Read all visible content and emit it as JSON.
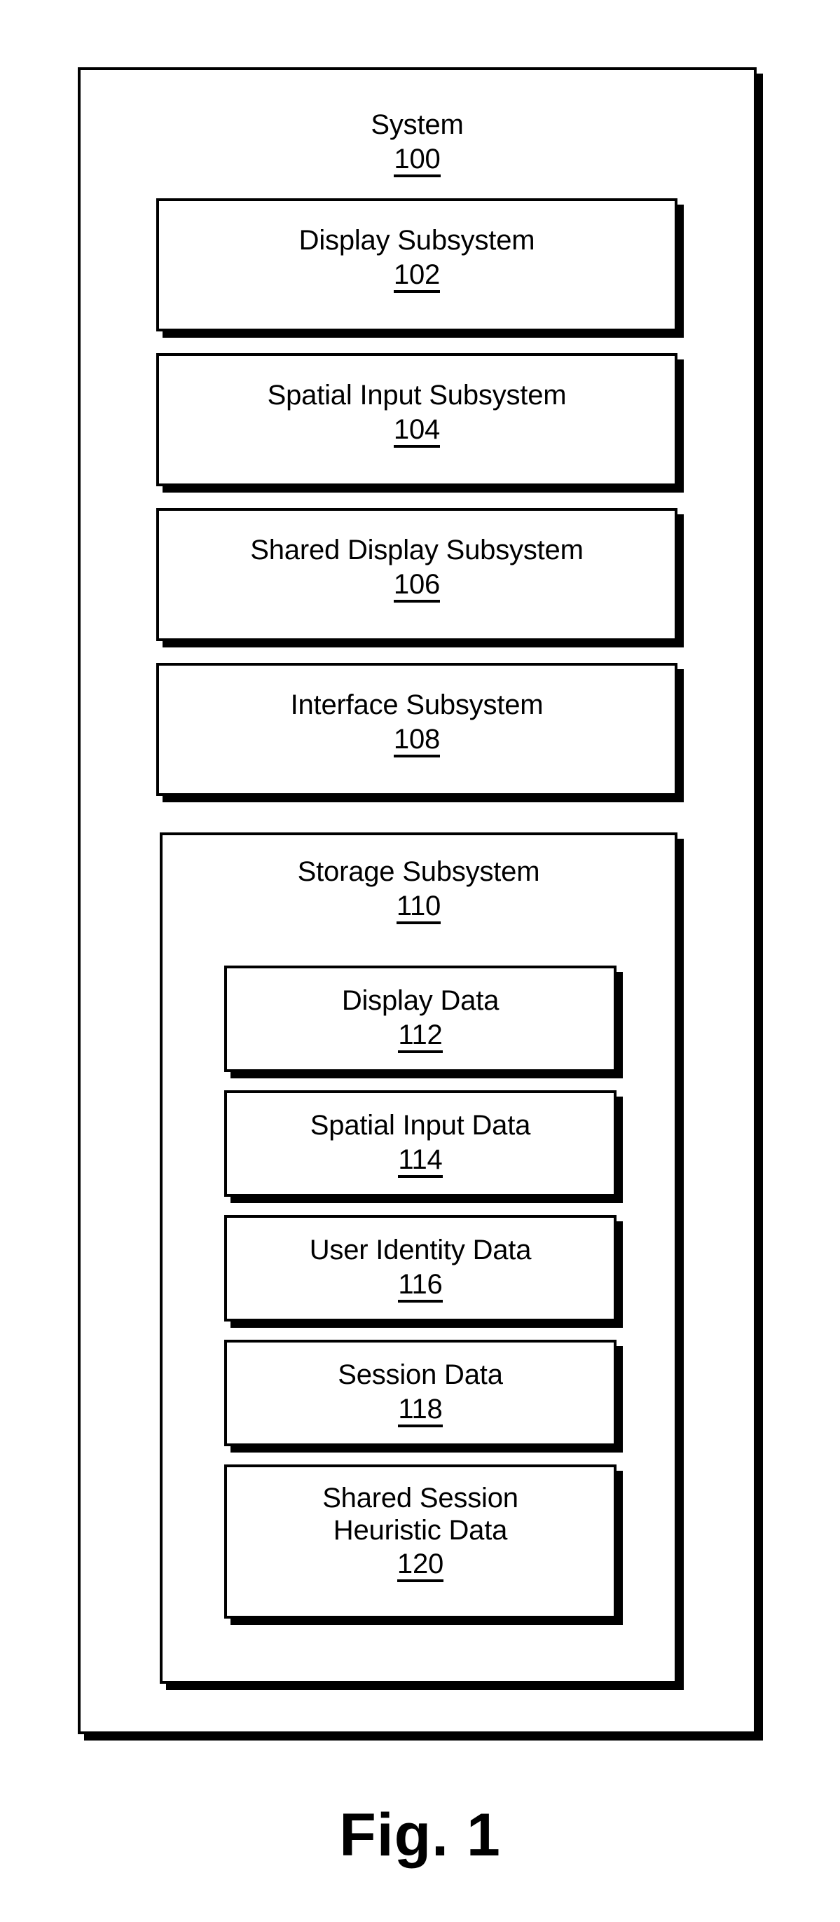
{
  "figure": {
    "caption": "Fig. 1"
  },
  "system": {
    "title": "System",
    "ref": "100"
  },
  "subsystems": [
    {
      "title": "Display Subsystem",
      "ref": "102"
    },
    {
      "title": "Spatial Input Subsystem",
      "ref": "104"
    },
    {
      "title": "Shared Display Subsystem",
      "ref": "106"
    },
    {
      "title": "Interface Subsystem",
      "ref": "108"
    }
  ],
  "storage": {
    "title": "Storage Subsystem",
    "ref": "110",
    "items": [
      {
        "title": "Display Data",
        "ref": "112"
      },
      {
        "title": "Spatial Input Data",
        "ref": "114"
      },
      {
        "title": "User Identity Data",
        "ref": "116"
      },
      {
        "title": "Session Data",
        "ref": "118"
      },
      {
        "title": "Shared Session\nHeuristic Data",
        "ref": "120"
      }
    ]
  },
  "colors": {
    "stroke": "#000000",
    "fill": "#ffffff",
    "shadow": "#000000"
  }
}
